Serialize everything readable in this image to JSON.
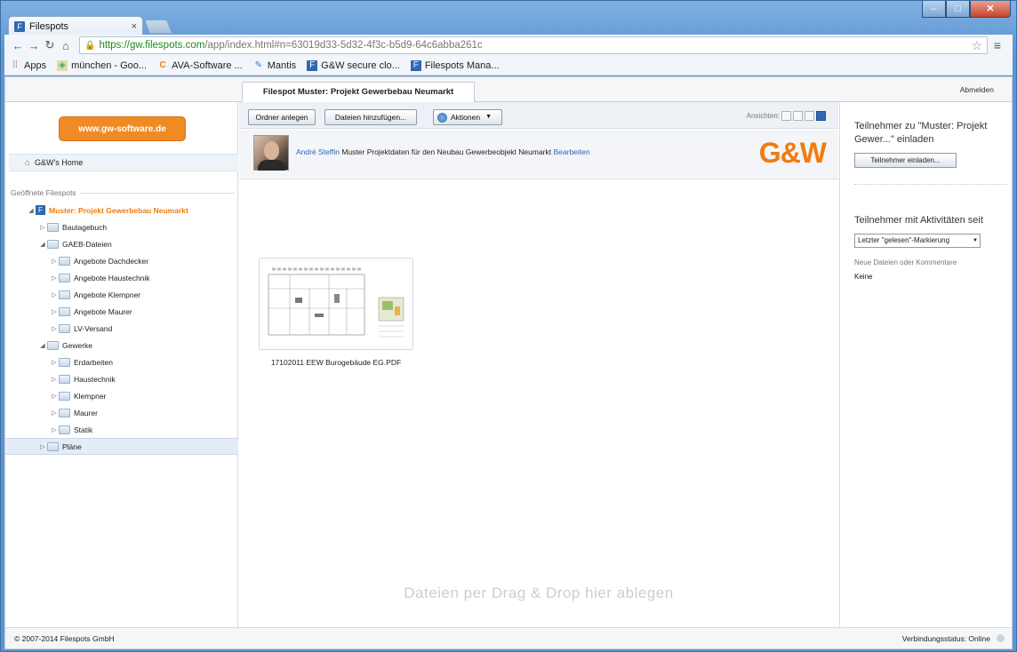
{
  "browser": {
    "tab_title": "Filespots",
    "tab_close": "×",
    "url_host": "https://gw.filespots.com",
    "url_rest": "/app/index.html#n=63019d33-5d32-4f3c-b5d9-64c6abba261c",
    "bookmarks": [
      {
        "label": "Apps",
        "icon": "apps-icon"
      },
      {
        "label": "münchen - Goo...",
        "icon": "maps-icon"
      },
      {
        "label": "AVA-Software ...",
        "icon": "ava-icon"
      },
      {
        "label": "Mantis",
        "icon": "mantis-icon"
      },
      {
        "label": "G&W secure clo...",
        "icon": "filespots-icon"
      },
      {
        "label": "Filespots Mana...",
        "icon": "filespots-icon"
      }
    ]
  },
  "app": {
    "tab_label": "Filespot Muster: Projekt Gewerbebau Neumarkt",
    "logout_label": "Abmelden"
  },
  "sidebar": {
    "site_button": "www.gw-software.de",
    "home_label": "G&W's Home",
    "section_label": "Geöffnete Filespots",
    "tree": [
      {
        "label": "Muster: Projekt Gewerbebau Neumarkt",
        "level": 0,
        "twisty": "◢",
        "type": "spot"
      },
      {
        "label": "Bautagebuch",
        "level": 1,
        "twisty": "▷",
        "type": "folder"
      },
      {
        "label": "GAEB-Dateien",
        "level": 1,
        "twisty": "◢",
        "type": "folder"
      },
      {
        "label": "Angebote Dachdecker",
        "level": 2,
        "twisty": "▷",
        "type": "folder"
      },
      {
        "label": "Angebote Haustechnik",
        "level": 2,
        "twisty": "▷",
        "type": "folder"
      },
      {
        "label": "Angebote Klempner",
        "level": 2,
        "twisty": "▷",
        "type": "folder"
      },
      {
        "label": "Angebote Maurer",
        "level": 2,
        "twisty": "▷",
        "type": "folder"
      },
      {
        "label": "LV-Versand",
        "level": 2,
        "twisty": "▷",
        "type": "folder"
      },
      {
        "label": "Gewerke",
        "level": 1,
        "twisty": "◢",
        "type": "folder"
      },
      {
        "label": "Erdarbeiten",
        "level": 2,
        "twisty": "▷",
        "type": "folder"
      },
      {
        "label": "Haustechnik",
        "level": 2,
        "twisty": "▷",
        "type": "folder"
      },
      {
        "label": "Klempner",
        "level": 2,
        "twisty": "▷",
        "type": "folder"
      },
      {
        "label": "Maurer",
        "level": 2,
        "twisty": "▷",
        "type": "folder"
      },
      {
        "label": "Statik",
        "level": 2,
        "twisty": "▷",
        "type": "folder"
      },
      {
        "label": "Pläne",
        "level": 1,
        "twisty": "▷",
        "type": "folder",
        "selected": true
      }
    ]
  },
  "main": {
    "new_folder_button": "Ordner anlegen",
    "add_files_button": "Dateien hinzufügen...",
    "actions_button": "Aktionen",
    "views_label": "Ansichten:",
    "owner_name": "André Steffin",
    "description": " Muster Projektdaten für den Neubau Gewerbeobjekt Neumarkt ",
    "edit_link": "Bearbeiten",
    "logo_text": "G&W",
    "file_name": "17102011 EEW Burogebäude EG.PDF",
    "dropzone_text": "Dateien per Drag & Drop hier ablegen"
  },
  "right_panel": {
    "invite_title": "Teilnehmer zu \"Muster: Projekt Gewer...\" einladen",
    "invite_button": "Teilnehmer einladen...",
    "activity_title": "Teilnehmer mit Aktivitäten seit",
    "activity_select": "Letzter \"gelesen\"-Markierung",
    "new_files_label": "Neue Dateien oder Kommentare",
    "new_files_value": "Keine"
  },
  "footer": {
    "copyright": "© 2007-2014 Filespots GmbH",
    "connection_status": "Verbindungsstatus: Online"
  },
  "colors": {
    "accent_orange": "#f07b10",
    "link_blue": "#2f67b5"
  }
}
